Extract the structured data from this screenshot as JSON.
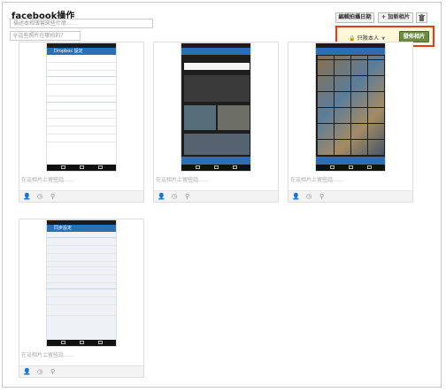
{
  "header": {
    "title": "facebook操作",
    "description_placeholder": "描述本相簿嘗來些什麼……",
    "location_placeholder": "這些照片在哪拍的？"
  },
  "toolbar": {
    "edit_date_label": "編輯拍攝日期",
    "add_photo_label": "+ 加新相片",
    "delete_icon": "trash-icon"
  },
  "publish": {
    "privacy_label": "只限本人",
    "privacy_icon": "lock-icon",
    "publish_label": "發佈相片",
    "highlight_color": "#e23c1b",
    "button_color": "#6d8a45"
  },
  "photos": [
    {
      "caption": "在這相片上留些話……",
      "screen": "Dropbox 設定"
    },
    {
      "caption": "在這相片上留些話……",
      "screen": "gallery"
    },
    {
      "caption": "在這相片上留些話……",
      "screen": "grid"
    },
    {
      "caption": "在這相片上留些話……",
      "screen": "同步設定"
    }
  ],
  "photo_tools": [
    "tag-person-icon",
    "clock-icon",
    "location-pin-icon"
  ]
}
